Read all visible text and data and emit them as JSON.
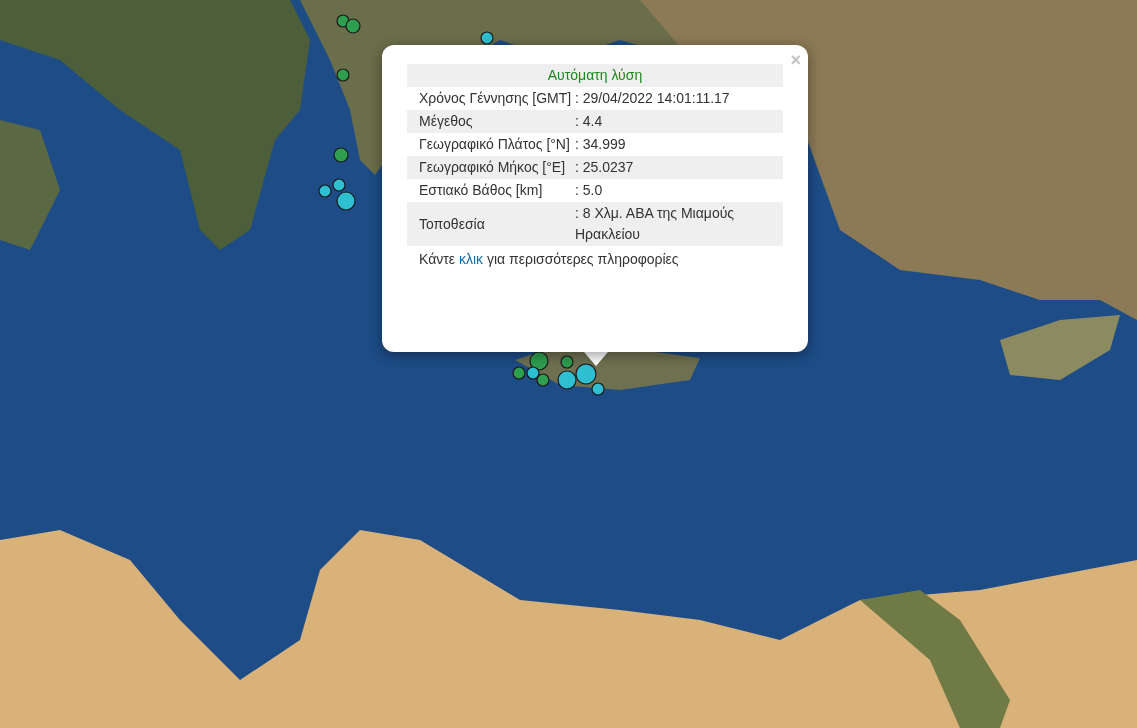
{
  "markers": [
    {
      "color": "#2e9e4f"
    },
    {
      "color": "#2e9e4f"
    },
    {
      "color": "#2fbfd3"
    },
    {
      "color": "#2e9e4f"
    },
    {
      "color": "#2e9e4f"
    },
    {
      "color": "#2fbfd3"
    },
    {
      "color": "#2fbfd3"
    },
    {
      "color": "#2fbfd3"
    },
    {
      "color": "#2e9e4f"
    },
    {
      "color": "#2e9e4f"
    },
    {
      "color": "#2e9e4f"
    },
    {
      "color": "#2fbfd3"
    },
    {
      "color": "#2e9e4f"
    },
    {
      "color": "#2fbfd3"
    },
    {
      "color": "#2fbfd3"
    },
    {
      "color": "#2fbfd3"
    }
  ],
  "popup": {
    "close": "×",
    "heading": "Αυτόματη λύση",
    "rows": [
      {
        "label": "Χρόνος Γέννησης [GMT]",
        "value": ": 29/04/2022 14:01:11.17"
      },
      {
        "label": "Μέγεθος",
        "value": ": 4.4"
      },
      {
        "label": "Γεωγραφικό Πλάτος [°N]",
        "value": ": 34.999"
      },
      {
        "label": "Γεωγραφικό Μήκος [°E]",
        "value": ": 25.0237"
      },
      {
        "label": "Εστιακό Βάθος [km]",
        "value": ": 5.0"
      },
      {
        "label": "Τοποθεσία",
        "value": ": 8 Χλμ. ΑΒΑ της Μιαμούς Ηρακλείου"
      }
    ],
    "footer": {
      "before": "Κάντε ",
      "link": "κλικ",
      "after": " για περισσότερες πληροφορίες"
    }
  }
}
